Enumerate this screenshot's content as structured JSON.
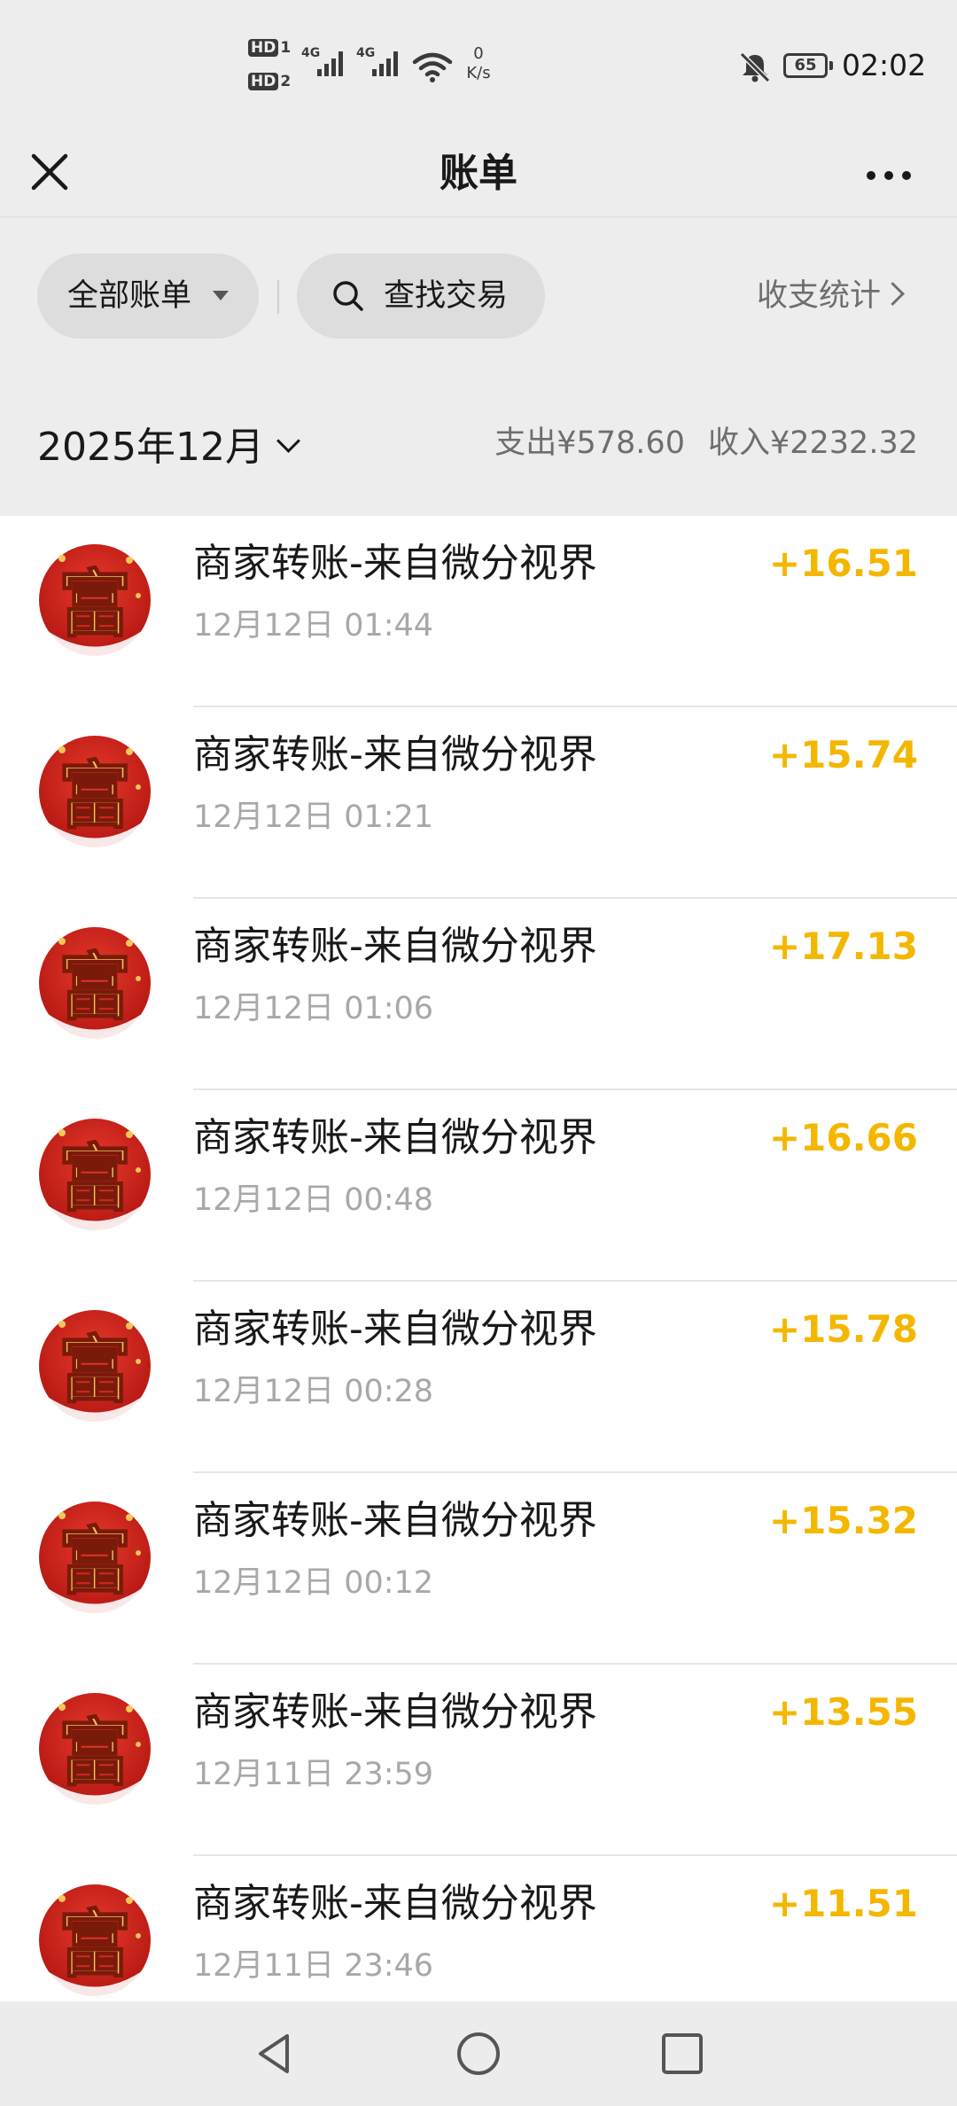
{
  "status_bar": {
    "hd1_label": "HD",
    "hd1_index": "1",
    "hd2_label": "HD",
    "hd2_index": "2",
    "sim1_network": "4G",
    "sim2_network": "4G",
    "net_speed_value": "0",
    "net_speed_unit": "K/s",
    "battery": "65",
    "time": "02:02",
    "icons": [
      "signal-icon",
      "wifi-icon",
      "notifications-muted-icon",
      "battery-icon"
    ]
  },
  "nav": {
    "title": "账单",
    "close_icon": "close-icon",
    "more_icon": "more-icon"
  },
  "filters": {
    "all_bills": "全部账单",
    "search": "查找交易",
    "stats": "收支统计"
  },
  "summary": {
    "month": "2025年12月",
    "expense_label": "支出",
    "expense_value": "¥578.60",
    "income_label": "收入",
    "income_value": "¥2232.32"
  },
  "transactions": [
    {
      "title": "商家转账-来自微分视界",
      "time": "12月12日 01:44",
      "amount": "+16.51"
    },
    {
      "title": "商家转账-来自微分视界",
      "time": "12月12日 01:21",
      "amount": "+15.74"
    },
    {
      "title": "商家转账-来自微分视界",
      "time": "12月12日 01:06",
      "amount": "+17.13"
    },
    {
      "title": "商家转账-来自微分视界",
      "time": "12月12日 00:48",
      "amount": "+16.66"
    },
    {
      "title": "商家转账-来自微分视界",
      "time": "12月12日 00:28",
      "amount": "+15.78"
    },
    {
      "title": "商家转账-来自微分视界",
      "time": "12月12日 00:12",
      "amount": "+15.32"
    },
    {
      "title": "商家转账-来自微分视界",
      "time": "12月11日 23:59",
      "amount": "+13.55"
    },
    {
      "title": "商家转账-来自微分视界",
      "time": "12月11日 23:46",
      "amount": "+11.51"
    }
  ],
  "avatar": {
    "glyph": "富",
    "bg_color": "#c8231c",
    "glyph_color": "#f3c35a"
  },
  "colors": {
    "income_amount": "#f4b700",
    "background": "#ededed",
    "list_background": "#ffffff"
  },
  "system_nav": {
    "icons": [
      "back-icon",
      "home-icon",
      "recents-icon"
    ]
  }
}
